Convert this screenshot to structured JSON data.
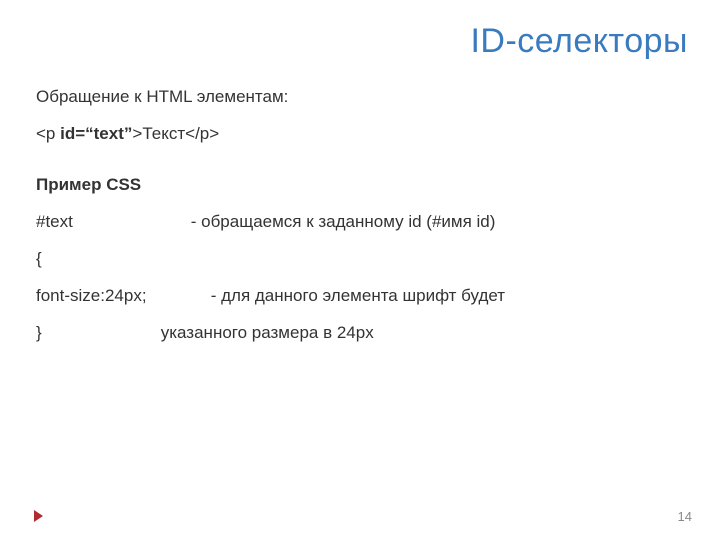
{
  "title": "ID-селекторы",
  "intro": "Обращение к HTML элементам:",
  "example_html": {
    "open_tag_prefix": "<p ",
    "attr": "id=“text”",
    "open_tag_suffix": ">",
    "text": "Текст",
    "close_tag": "</p>"
  },
  "css_heading": "Пример CSS",
  "lines": {
    "l1_code": "#text",
    "l1_comment": "- обращаемся к заданному id (#имя id)",
    "l2": "{",
    "l3_code": "font-size:24px;",
    "l3_comment": "- для данного элемента шрифт будет",
    "l4_code": "}",
    "l4_comment": "указанного размера в 24px"
  },
  "page_number": "14"
}
